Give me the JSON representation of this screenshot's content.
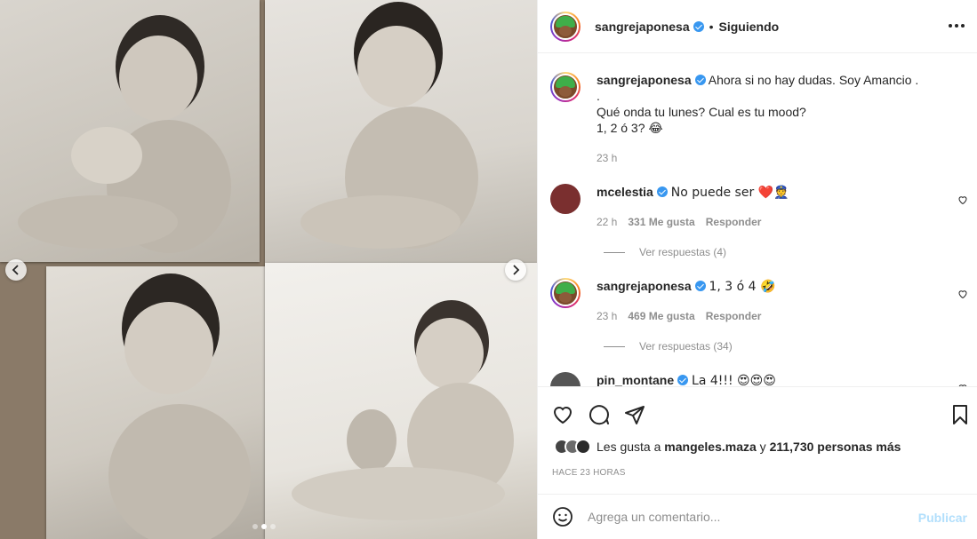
{
  "post": {
    "username": "sangrejaponesa",
    "separator": "•",
    "follow_state": "Siguiendo",
    "more_icon": "more-horizontal-icon"
  },
  "caption": {
    "username": "sangrejaponesa",
    "line1": "Ahora si no hay dudas. Soy Amancio .",
    "line2": ".",
    "line3": "Qué onda tu lunes? Cual es tu mood?",
    "line4": "1, 2 ó 3? 😂",
    "time": "23 h"
  },
  "comments": [
    {
      "username": "mcelestia",
      "text": "No puede ser ❤️👮",
      "time": "22 h",
      "likes": "331 Me gusta",
      "reply": "Responder",
      "view_replies": "Ver respuestas (4)"
    },
    {
      "username": "sangrejaponesa",
      "text": "1, 3 ó 4 🤣",
      "time": "23 h",
      "likes": "469 Me gusta",
      "reply": "Responder",
      "view_replies": "Ver respuestas (34)"
    },
    {
      "username": "pin_montane",
      "text": "La 4!!! 😍😍😍"
    }
  ],
  "likes": {
    "prefix": "Les gusta a",
    "user": "mangeles.maza",
    "conj": "y",
    "others": "211,730 personas más"
  },
  "time_ago": "HACE 23 HORAS",
  "add_comment": {
    "placeholder": "Agrega un comentario...",
    "publish": "Publicar"
  },
  "carousel": {
    "current_index": 1,
    "total": 3
  },
  "colors": {
    "verified": "#3897f0",
    "publish_disabled": "#b2dffc",
    "link": "#262626"
  }
}
